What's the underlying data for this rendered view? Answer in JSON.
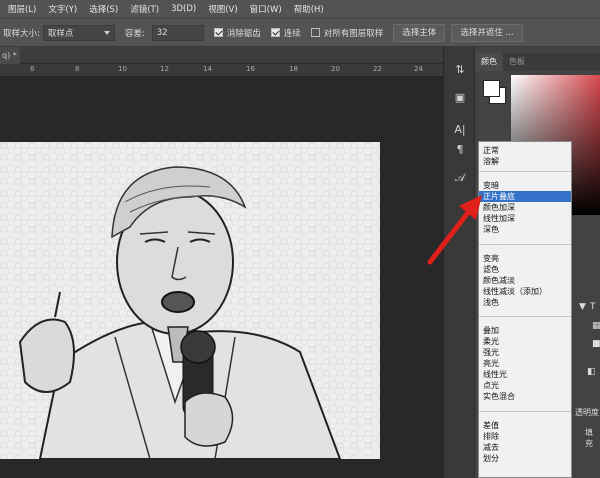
{
  "menubar": {
    "items": [
      "图层(L)",
      "文字(Y)",
      "选择(S)",
      "滤镜(T)",
      "3D(D)",
      "视图(V)",
      "窗口(W)",
      "帮助(H)"
    ]
  },
  "options": {
    "sample_size_label": "取样大小:",
    "sample_size_value": "取样点",
    "tolerance_label": "容差:",
    "tolerance_value": "32",
    "antialias_label": "消除锯齿",
    "contiguous_label": "连续",
    "all_layers_label": "对所有图层取样",
    "select_subject_label": "选择主体",
    "select_mask_label": "选择并遮住 ..."
  },
  "doc_tab": {
    "label": "q) *",
    "close": "×"
  },
  "ruler": {
    "ticks": [
      "6",
      "8",
      "10",
      "12",
      "14",
      "16",
      "18",
      "20",
      "22",
      "24"
    ]
  },
  "panel": {
    "tabs": [
      "颜色",
      "色板"
    ],
    "collapse": "«"
  },
  "side": {
    "opacity_label": "透明度",
    "fill_label": "填充",
    "t_icon": "T"
  },
  "blend_modes": {
    "groups": [
      [
        "正常",
        "溶解"
      ],
      [
        "变暗",
        "正片叠底",
        "颜色加深",
        "线性加深",
        "深色"
      ],
      [
        "变亮",
        "滤色",
        "颜色减淡",
        "线性减淡（添加）",
        "浅色"
      ],
      [
        "叠加",
        "柔光",
        "强光",
        "亮光",
        "线性光",
        "点光",
        "实色混合"
      ],
      [
        "差值",
        "排除",
        "减去",
        "划分"
      ]
    ],
    "selected": "正片叠底"
  },
  "colors": {
    "highlight": "#3471c8",
    "arrow": "#e0201a"
  }
}
